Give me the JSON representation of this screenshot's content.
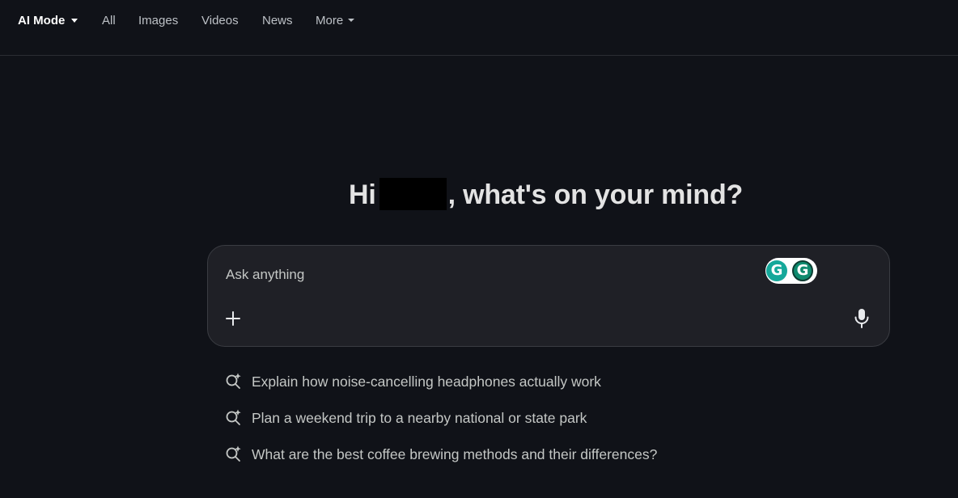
{
  "nav": {
    "tabs": [
      {
        "label": "AI Mode",
        "active": true,
        "has_dropdown": true
      },
      {
        "label": "All"
      },
      {
        "label": "Images"
      },
      {
        "label": "Videos"
      },
      {
        "label": "News"
      },
      {
        "label": "More",
        "has_dropdown": true
      }
    ]
  },
  "greeting": {
    "prefix": "Hi",
    "suffix": ", what's on your mind?"
  },
  "search": {
    "placeholder": "Ask anything",
    "value": "",
    "plus_icon": "plus-icon",
    "mic_icon": "microphone-icon",
    "extension_badges": [
      "G",
      "G"
    ]
  },
  "suggestions": [
    {
      "icon": "search-sparkle-icon",
      "text": "Explain how noise-cancelling headphones actually work"
    },
    {
      "icon": "search-sparkle-icon",
      "text": "Plan a weekend trip to a nearby national or state park"
    },
    {
      "icon": "search-sparkle-icon",
      "text": "What are the best coffee brewing methods and their differences?"
    }
  ],
  "colors": {
    "background": "#101218",
    "search_box": "#1f2026",
    "text_primary": "#e3e3e3",
    "text_secondary": "#c4c7c5",
    "grammarly_green": "#15a89a"
  }
}
